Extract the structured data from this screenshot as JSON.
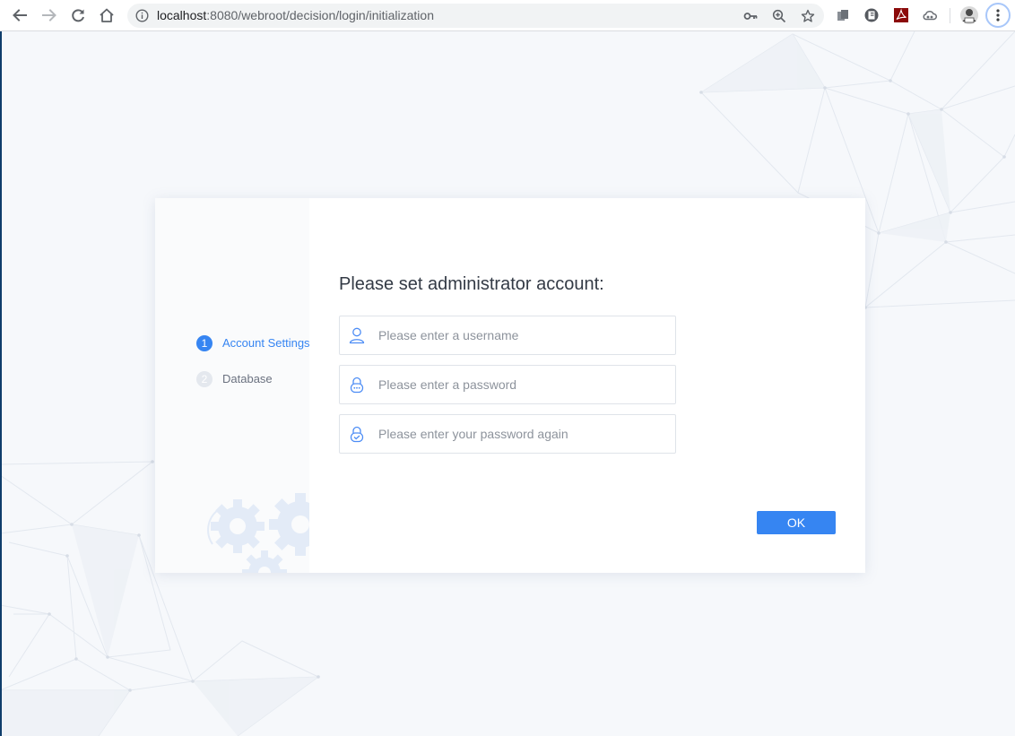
{
  "browser": {
    "url_host": "localhost",
    "url_rest": ":8080/webroot/decision/login/initialization",
    "icons": {
      "back": "arrow-left-icon",
      "forward": "arrow-right-icon",
      "reload": "reload-icon",
      "home": "home-icon",
      "site_info": "info-icon",
      "password": "key-icon",
      "zoom": "zoom-in-icon",
      "bookmark": "star-icon",
      "menu": "kebab-menu-icon"
    }
  },
  "dialog": {
    "title": "Please set administrator account:",
    "steps": [
      {
        "number": "1",
        "label": "Account Settings",
        "state": "active"
      },
      {
        "number": "2",
        "label": "Database",
        "state": "inactive"
      }
    ],
    "fields": {
      "username": {
        "placeholder": "Please enter a username",
        "value": ""
      },
      "password": {
        "placeholder": "Please enter a password",
        "value": ""
      },
      "password_again": {
        "placeholder": "Please enter your password again",
        "value": ""
      }
    },
    "ok_label": "OK"
  },
  "colors": {
    "accent": "#3685f2",
    "page_background": "#f6f8fb",
    "inactive_step": "#e4e8ee"
  }
}
